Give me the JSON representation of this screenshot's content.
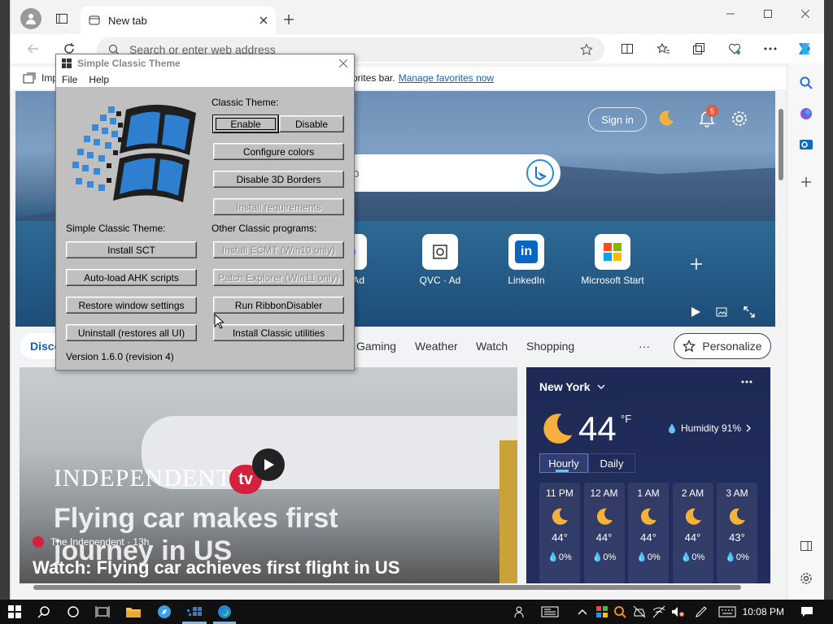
{
  "browser": {
    "tab_title": "New tab",
    "address_placeholder": "Search or enter web address",
    "favorites_prefix": "Imp",
    "favorites_message": "orites bar.",
    "favorites_link": "Manage favorites now"
  },
  "msn": {
    "signin": "Sign in",
    "notification_count": "5",
    "search_partial": "eb",
    "tiles": [
      {
        "label": "air · Ad"
      },
      {
        "label": "QVC · Ad"
      },
      {
        "label": "LinkedIn"
      },
      {
        "label": "Microsoft Start"
      }
    ],
    "nav": {
      "discover": "Disco",
      "items": [
        "Gaming",
        "Weather",
        "Watch",
        "Shopping"
      ],
      "more": "···",
      "personalize": "Personalize"
    },
    "news": {
      "brand": "INDEPENDENT",
      "tv": "tv",
      "overlay_title": "Flying car makes first journey in US",
      "source": "The Independent · 13h",
      "headline": "Watch: Flying car achieves first flight in US"
    },
    "weather": {
      "city": "New York",
      "temp": "44",
      "unit": "°F",
      "humidity": "Humidity 91%",
      "tab_hourly": "Hourly",
      "tab_daily": "Daily",
      "hours": [
        {
          "time": "11 PM",
          "temp": "44°",
          "precip": "0%"
        },
        {
          "time": "12 AM",
          "temp": "44°",
          "precip": "0%"
        },
        {
          "time": "1 AM",
          "temp": "44°",
          "precip": "0%"
        },
        {
          "time": "2 AM",
          "temp": "44°",
          "precip": "0%"
        },
        {
          "time": "3 AM",
          "temp": "43°",
          "precip": "0%"
        }
      ]
    }
  },
  "dialog": {
    "title": "Simple Classic Theme",
    "menu": [
      "File",
      "Help"
    ],
    "classic_theme_label": "Classic Theme:",
    "enable": "Enable",
    "disable": "Disable",
    "configure_colors": "Configure colors",
    "disable_3d": "Disable 3D Borders",
    "install_requirements": "Install requirements",
    "sct_label": "Simple Classic Theme:",
    "other_label": "Other Classic programs:",
    "install_sct": "Install SCT",
    "autoload_ahk": "Auto-load AHK scripts",
    "restore_window": "Restore window settings",
    "uninstall": "Uninstall (restores all UI)",
    "install_ecmt": "Install ECMT (Win10 only)",
    "patch_explorer": "Patch Explorer (Win11 only)",
    "run_ribbon": "Run RibbonDisabler",
    "install_utilities": "Install Classic utilities",
    "version": "Version 1.6.0 (revision 4)"
  },
  "taskbar": {
    "clock": "10:08 PM"
  },
  "colors": {
    "accent": "#1a5fb4",
    "classic_face": "#c0c0c0",
    "taskbar": "#101010"
  }
}
